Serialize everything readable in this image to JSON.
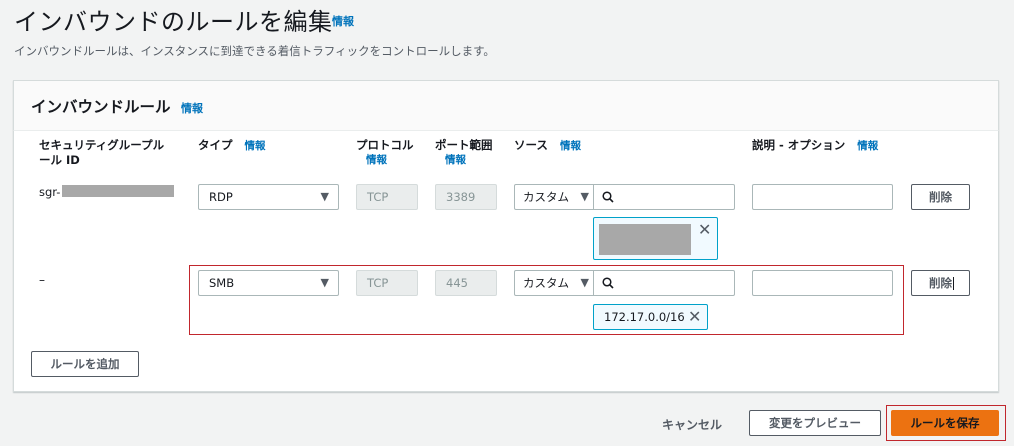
{
  "page": {
    "title": "インバウンドのルールを編集",
    "info": "情報",
    "subtitle": "インバウンドルールは、インスタンスに到達できる着信トラフィックをコントロールします。"
  },
  "panel": {
    "title": "インバウンドルール",
    "info": "情報"
  },
  "columns": {
    "rule_id_line1": "セキュリティグループル",
    "rule_id_line2": "ール ID",
    "type": "タイプ",
    "type_info": "情報",
    "protocol": "プロトコル",
    "protocol_info": "情報",
    "port": "ポート範囲",
    "port_info": "情報",
    "source": "ソース",
    "source_info": "情報",
    "description": "説明 - オプション",
    "description_info": "情報"
  },
  "rules": [
    {
      "rule_id": "sgr-",
      "type": "RDP",
      "protocol": "TCP",
      "port": "3389",
      "source_type": "カスタム",
      "source_search": "",
      "token": "",
      "description": "",
      "delete": "削除"
    },
    {
      "rule_id": "–",
      "type": "SMB",
      "protocol": "TCP",
      "port": "445",
      "source_type": "カスタム",
      "source_search": "",
      "token": "172.17.0.0/16",
      "description": "",
      "delete": "削除"
    }
  ],
  "add_rule": "ルールを追加",
  "footer": {
    "cancel": "キャンセル",
    "preview": "変更をプレビュー",
    "save": "ルールを保存"
  },
  "colors": {
    "accent_orange": "#ec7211",
    "link_blue": "#0073bb",
    "highlight_red": "#c1272d",
    "token_border": "#00a1c9"
  },
  "icons": {
    "caret": "caret-down-icon",
    "search": "search-icon",
    "remove": "close-icon"
  }
}
